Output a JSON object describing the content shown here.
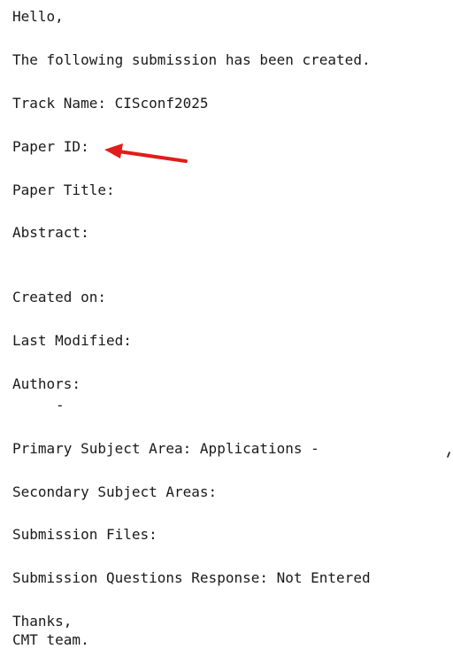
{
  "email": {
    "greeting": "Hello,",
    "intro": "The following submission has been created.",
    "track_name": "Track Name: CISconf2025",
    "paper_id": "Paper ID:",
    "paper_title": "Paper Title:",
    "abstract": "Abstract:",
    "created_on": "Created on:",
    "last_modified": "Last Modified:",
    "authors": "Authors:",
    "author_entry": "-",
    "primary_subject_area": "Primary Subject Area: Applications -",
    "secondary_subject_areas": "Secondary Subject Areas:",
    "submission_files": "Submission Files:",
    "questions_response": "Submission Questions Response: Not Entered",
    "thanks": "Thanks,",
    "signature": "CMT team."
  },
  "colors": {
    "text": "#1a1a1a",
    "arrow": "#e31b1b",
    "background": "#ffffff"
  },
  "icons": {
    "annotation": "red-arrow-icon"
  }
}
